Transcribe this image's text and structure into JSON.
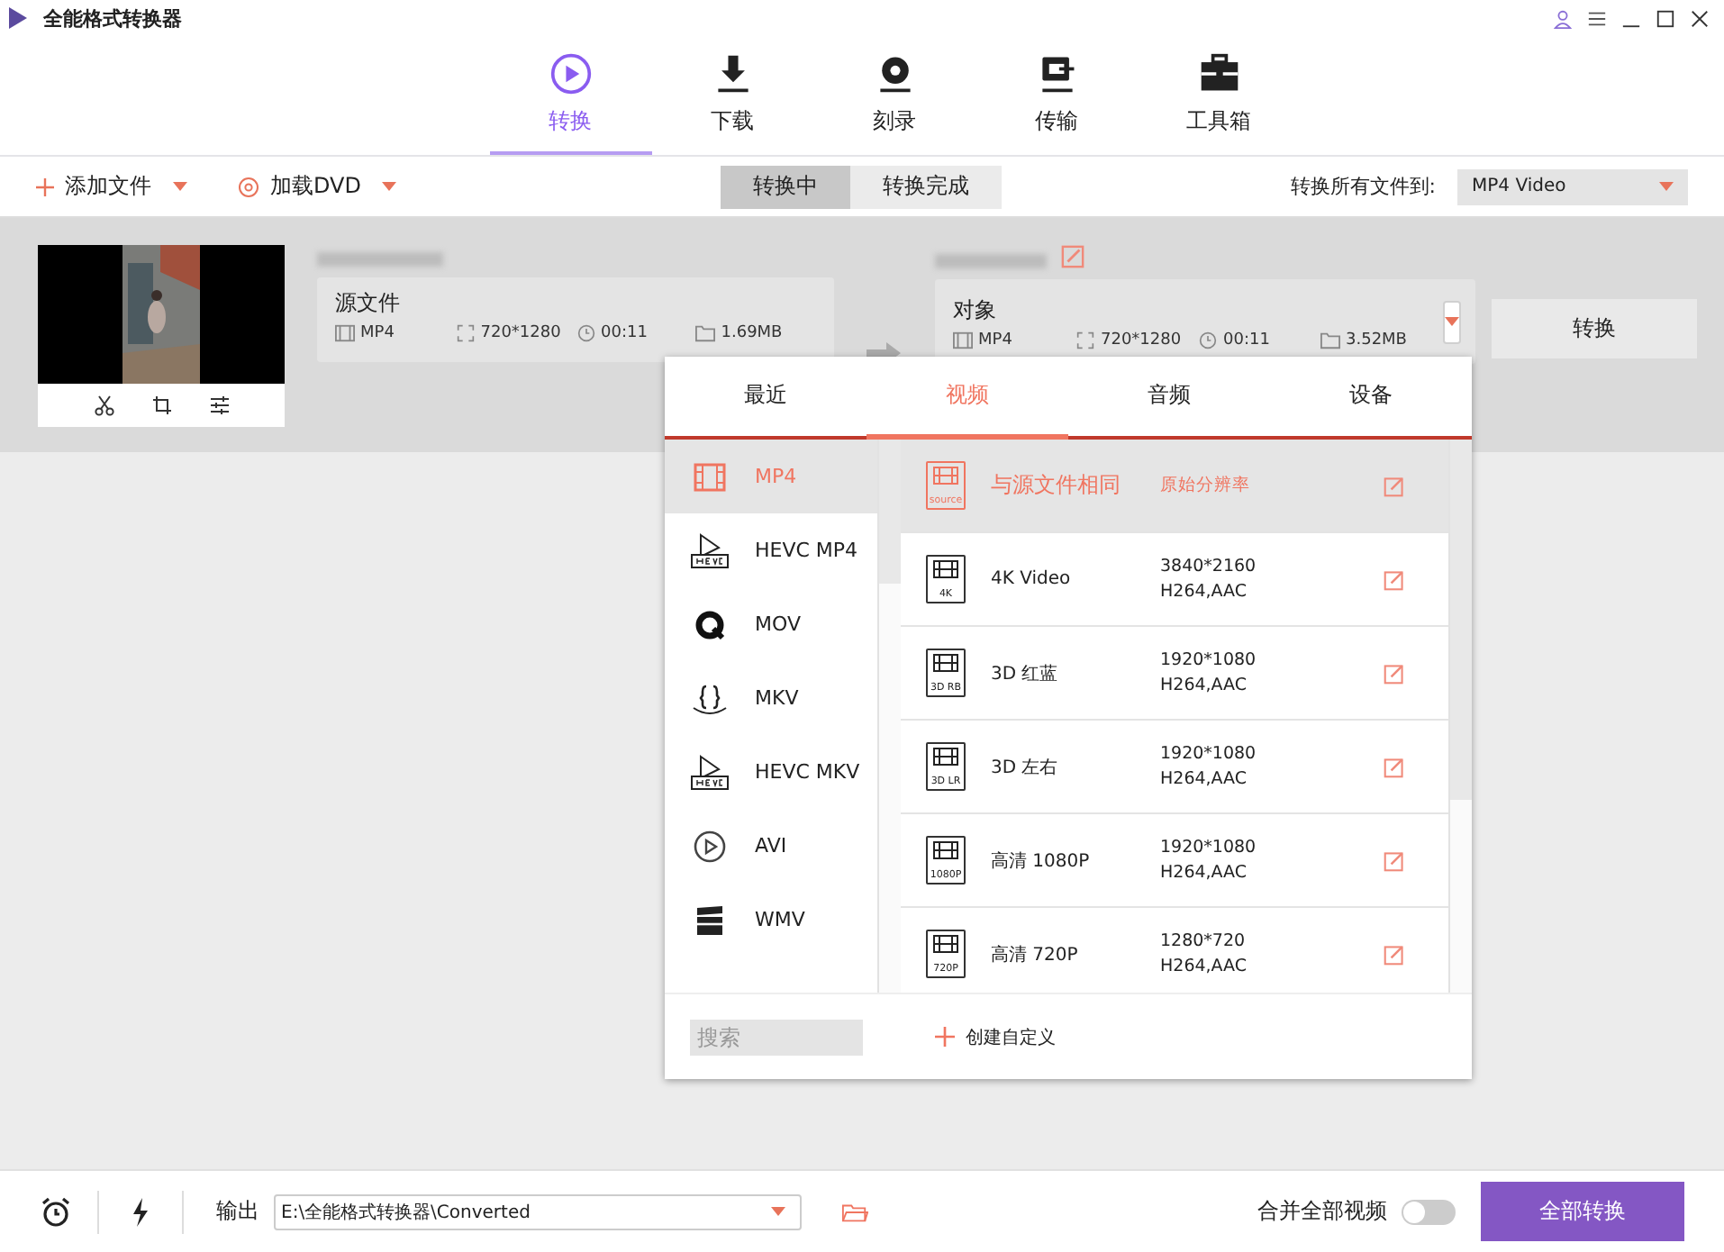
{
  "window": {
    "title": "全能格式转换器"
  },
  "nav_tabs": [
    {
      "label": "转换",
      "kind": "convert",
      "selected": true
    },
    {
      "label": "下载",
      "kind": "download",
      "selected": false
    },
    {
      "label": "刻录",
      "kind": "disc",
      "selected": false
    },
    {
      "label": "传输",
      "kind": "transfer",
      "selected": false
    },
    {
      "label": "工具箱",
      "kind": "toolbox",
      "selected": false
    }
  ],
  "toolbar": {
    "add_file": "添加文件",
    "load_dvd": "加载DVD",
    "status_tabs": [
      {
        "label": "转换中",
        "selected": true
      },
      {
        "label": "转换完成",
        "selected": false
      }
    ],
    "convert_all_label": "转换所有文件到:",
    "target_format": "MP4 Video"
  },
  "file": {
    "source": {
      "label": "源文件",
      "format": "MP4",
      "resolution": "720*1280",
      "duration": "00:11",
      "size": "1.69MB"
    },
    "target": {
      "label": "对象",
      "format": "MP4",
      "resolution": "720*1280",
      "duration": "00:11",
      "size": "3.52MB"
    },
    "convert_button": "转换"
  },
  "format_popup": {
    "tabs": [
      {
        "label": "最近",
        "selected": false
      },
      {
        "label": "视频",
        "selected": true
      },
      {
        "label": "音频",
        "selected": false
      },
      {
        "label": "设备",
        "selected": false
      }
    ],
    "formats": [
      {
        "label": "MP4",
        "kind": "film",
        "selected": true
      },
      {
        "label": "HEVC MP4",
        "kind": "hevc",
        "selected": false
      },
      {
        "label": "MOV",
        "kind": "quicktime",
        "selected": false
      },
      {
        "label": "MKV",
        "kind": "braces",
        "selected": false
      },
      {
        "label": "HEVC MKV",
        "kind": "hevc",
        "selected": false
      },
      {
        "label": "AVI",
        "kind": "play",
        "selected": false
      },
      {
        "label": "WMV",
        "kind": "clapper",
        "selected": false
      }
    ],
    "presets": [
      {
        "name": "与源文件相同",
        "badge": "source",
        "resolution": "原始分辨率",
        "selected": true
      },
      {
        "name": "4K Video",
        "badge": "4K",
        "resolution": "3840*2160",
        "codec": "H264,AAC",
        "selected": false
      },
      {
        "name": "3D 红蓝",
        "badge": "3D RB",
        "resolution": "1920*1080",
        "codec": "H264,AAC",
        "selected": false
      },
      {
        "name": "3D 左右",
        "badge": "3D LR",
        "resolution": "1920*1080",
        "codec": "H264,AAC",
        "selected": false
      },
      {
        "name": "高清 1080P",
        "badge": "1080P",
        "resolution": "1920*1080",
        "codec": "H264,AAC",
        "selected": false
      },
      {
        "name": "高清 720P",
        "badge": "720P",
        "resolution": "1280*720",
        "codec": "H264,AAC",
        "selected": false
      }
    ],
    "search": {
      "placeholder": "搜索"
    },
    "create_custom": "创建自定义"
  },
  "bottom": {
    "output_label": "输出",
    "output_path": "E:\\全能格式转换器\\Converted",
    "merge_label": "合并全部视频",
    "merge_on": false,
    "convert_all_button": "全部转换"
  }
}
